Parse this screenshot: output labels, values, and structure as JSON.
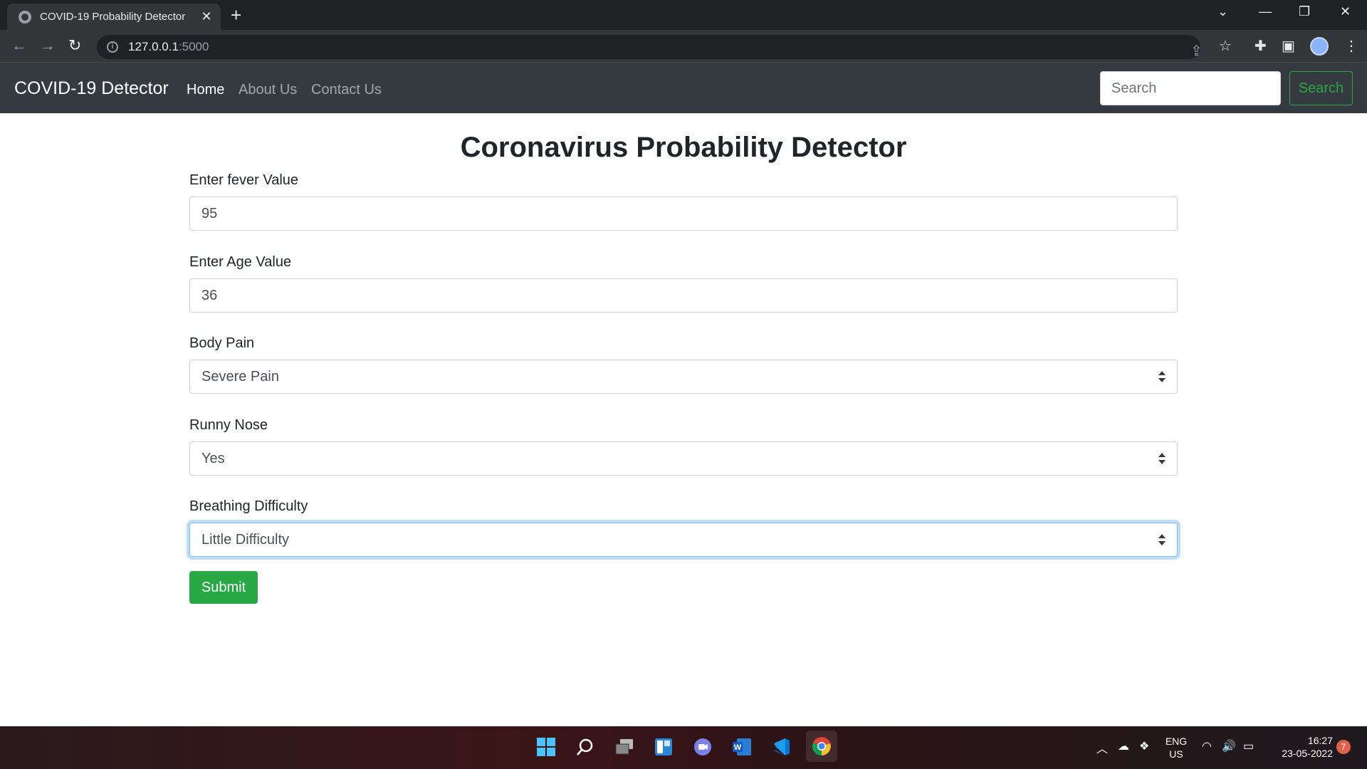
{
  "browser": {
    "tab_title": "COVID-19 Probability Detector",
    "url_host": "127.0.0.1",
    "url_port": ":5000"
  },
  "navbar": {
    "brand": "COVID-19 Detector",
    "links": [
      {
        "label": "Home",
        "active": true
      },
      {
        "label": "About Us",
        "active": false
      },
      {
        "label": "Contact Us",
        "active": false
      }
    ],
    "search_placeholder": "Search",
    "search_button": "Search"
  },
  "main": {
    "title": "Coronavirus Probability Detector",
    "fever": {
      "label": "Enter fever Value",
      "value": "95"
    },
    "age": {
      "label": "Enter Age Value",
      "value": "36"
    },
    "body_pain": {
      "label": "Body Pain",
      "selected": "Severe Pain"
    },
    "runny_nose": {
      "label": "Runny Nose",
      "selected": "Yes"
    },
    "breathing": {
      "label": "Breathing Difficulty",
      "selected": "Little Difficulty"
    },
    "submit": "Submit"
  },
  "taskbar": {
    "lang_top": "ENG",
    "lang_bottom": "US",
    "time": "16:27",
    "date": "23-05-2022",
    "notification_count": "7"
  },
  "colors": {
    "navbar_bg": "#343a40",
    "success": "#28a745",
    "focus": "#80bdff"
  }
}
